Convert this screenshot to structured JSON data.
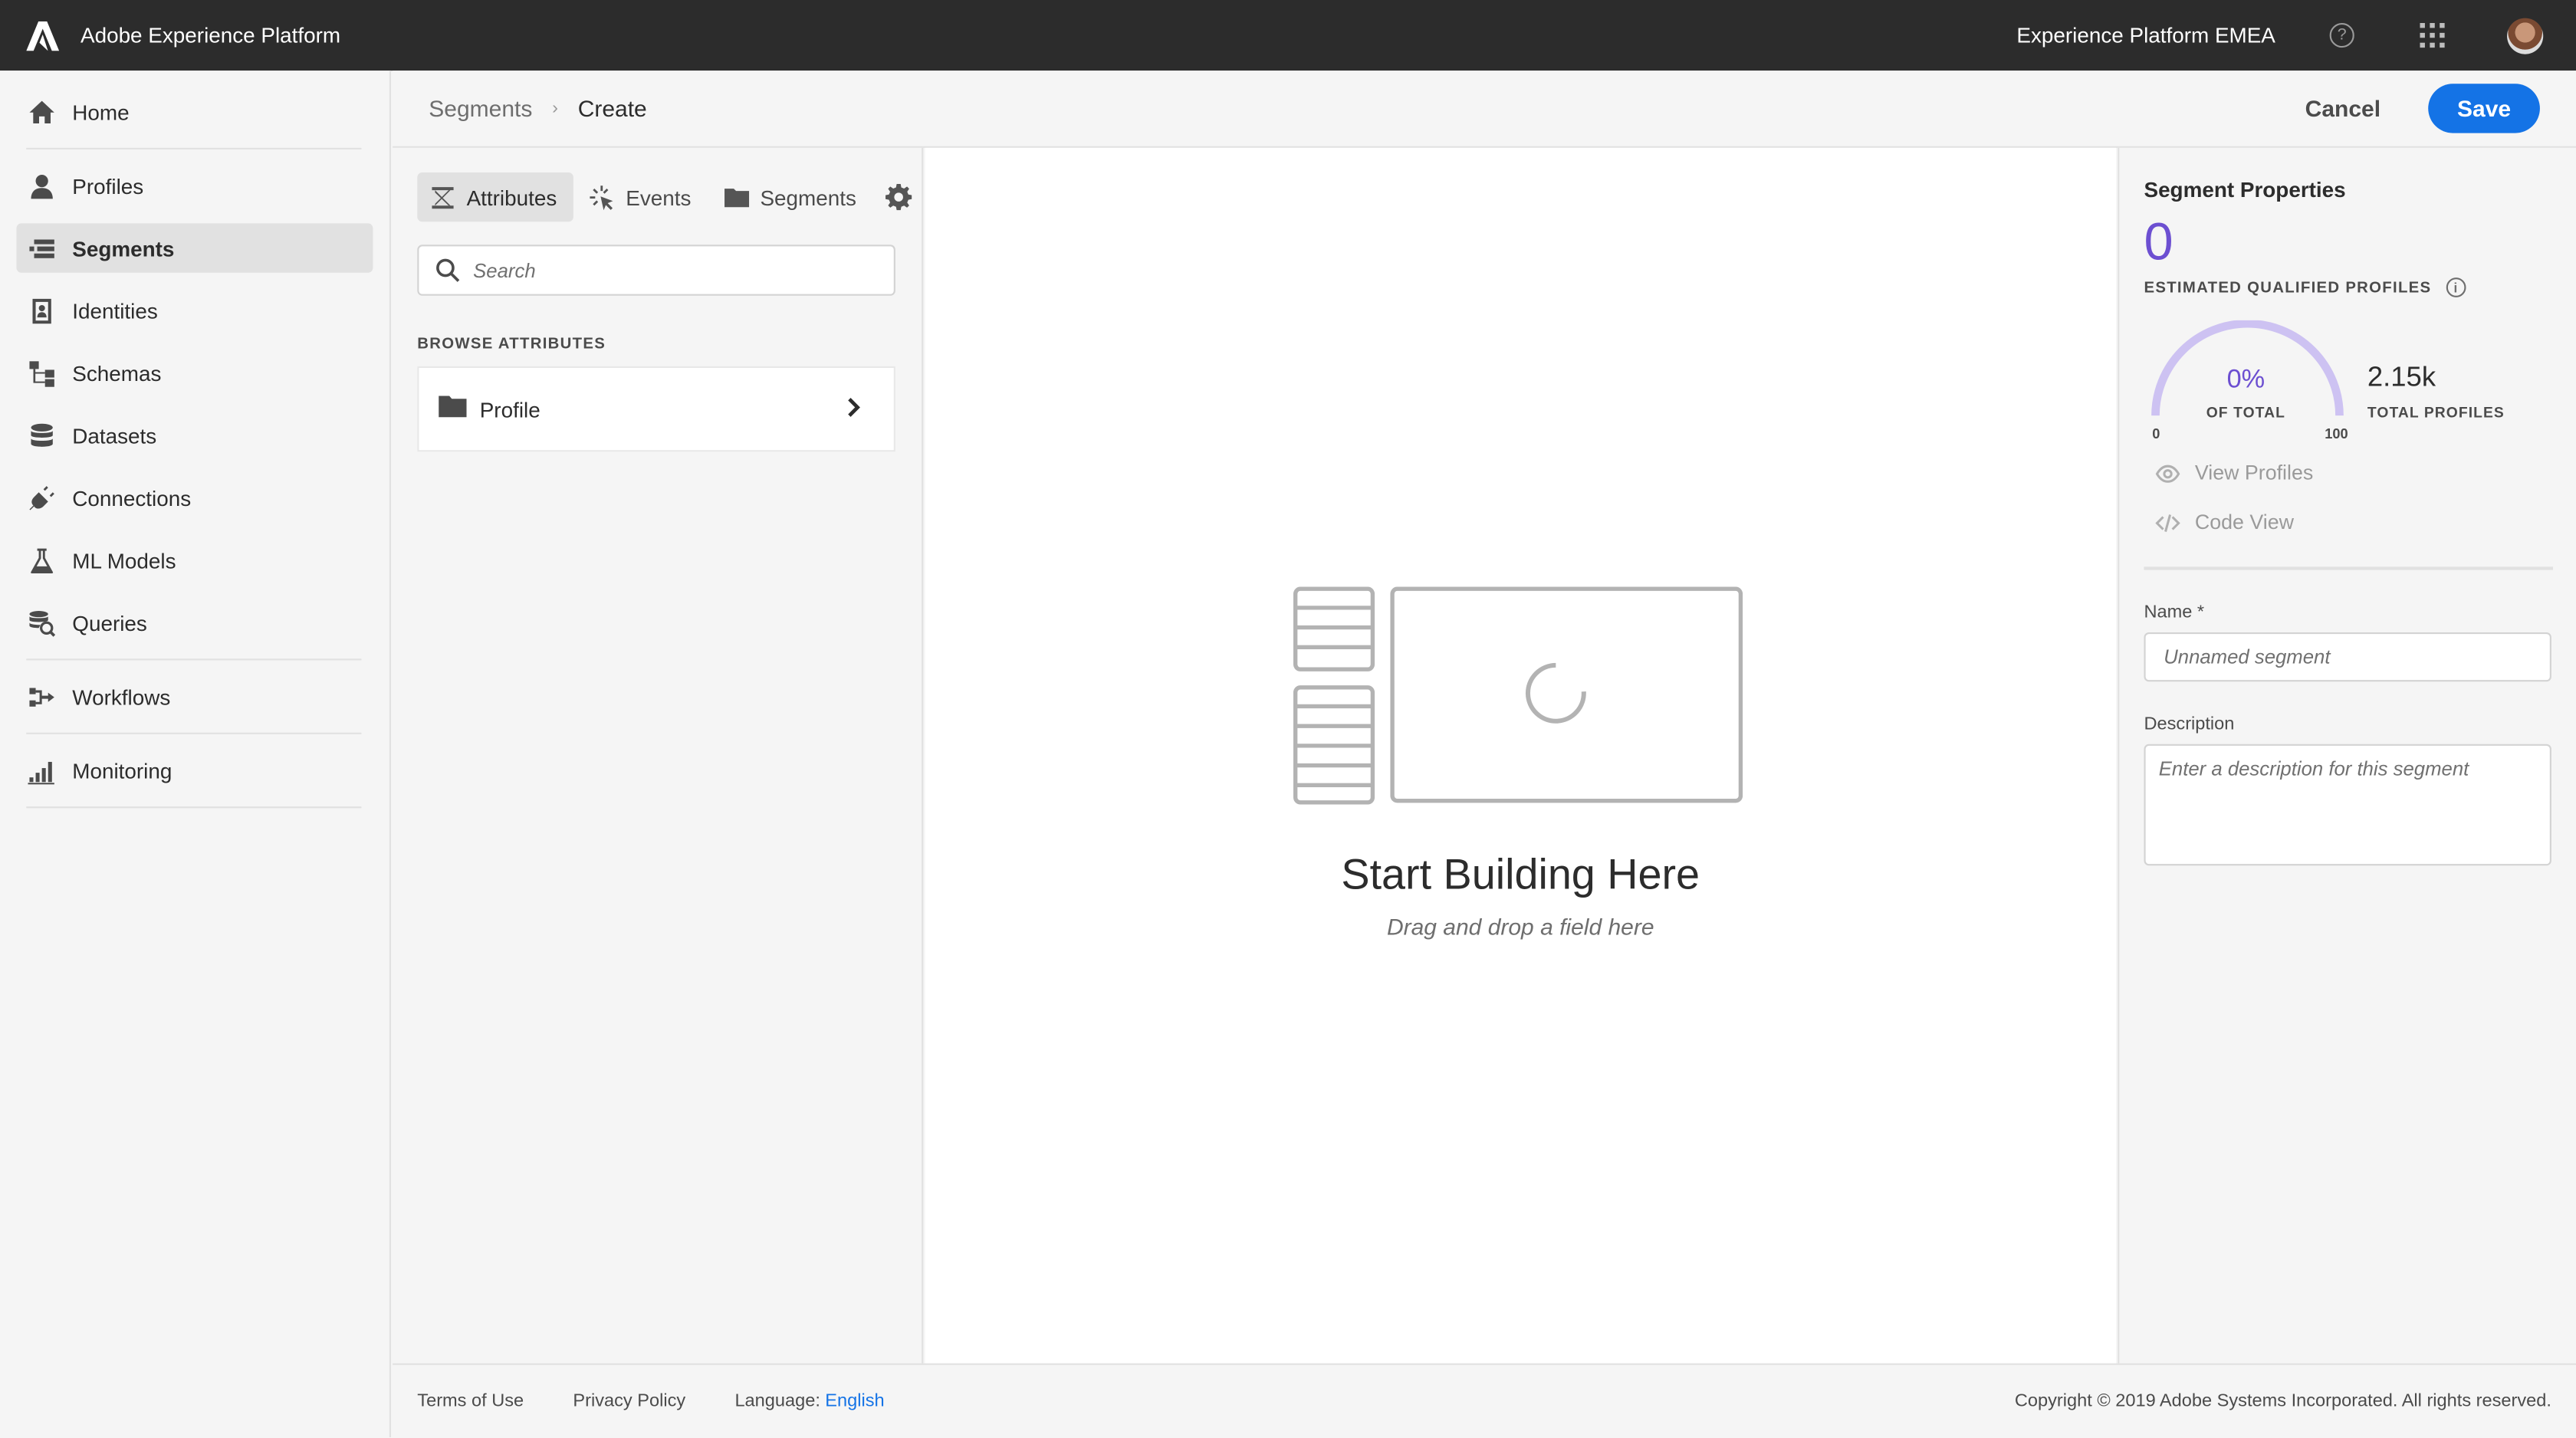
{
  "app": {
    "title": "Adobe Experience Platform",
    "org_name": "Experience Platform EMEA",
    "help_glyph": "?"
  },
  "sidebar": {
    "items": [
      {
        "label": "Home",
        "icon": "home-icon"
      },
      {
        "label": "Profiles",
        "icon": "profile-icon"
      },
      {
        "label": "Segments",
        "icon": "segments-icon",
        "active": true
      },
      {
        "label": "Identities",
        "icon": "identity-icon"
      },
      {
        "label": "Schemas",
        "icon": "schema-icon"
      },
      {
        "label": "Datasets",
        "icon": "database-icon"
      },
      {
        "label": "Connections",
        "icon": "plug-icon"
      },
      {
        "label": "ML Models",
        "icon": "flask-icon"
      },
      {
        "label": "Queries",
        "icon": "query-icon"
      },
      {
        "label": "Workflows",
        "icon": "workflow-icon"
      },
      {
        "label": "Monitoring",
        "icon": "chart-icon"
      }
    ]
  },
  "header": {
    "breadcrumb_parent": "Segments",
    "breadcrumb_separator": "›",
    "breadcrumb_current": "Create",
    "cancel_label": "Cancel",
    "save_label": "Save"
  },
  "left_panel": {
    "tabs": [
      {
        "label": "Attributes",
        "icon": "attributes-icon",
        "active": true
      },
      {
        "label": "Events",
        "icon": "events-icon"
      },
      {
        "label": "Segments",
        "icon": "folder-icon"
      }
    ],
    "search_placeholder": "Search",
    "browse_heading": "BROWSE ATTRIBUTES",
    "browse_item": "Profile"
  },
  "canvas": {
    "title": "Start Building Here",
    "subtitle": "Drag and drop a field here"
  },
  "properties": {
    "title": "Segment Properties",
    "estimate": "0",
    "estimate_label": "ESTIMATED QUALIFIED PROFILES",
    "info_glyph": "i",
    "gauge_percent": "0%",
    "gauge_of_total": "OF TOTAL",
    "gauge_min": "0",
    "gauge_max": "100",
    "total_profiles": "2.15k",
    "total_profiles_label": "TOTAL PROFILES",
    "view_profiles": "View Profiles",
    "code_view": "Code View",
    "name_label": "Name *",
    "name_placeholder": "Unnamed segment",
    "description_label": "Description",
    "description_placeholder": "Enter a description for this segment"
  },
  "footer": {
    "terms": "Terms of Use",
    "privacy": "Privacy Policy",
    "language_label": "Language:",
    "language_value": "English",
    "copyright": "Copyright ©  2019 Adobe Systems Incorporated.  All rights reserved."
  },
  "colors": {
    "accent": "#1473e6",
    "topbar": "#2c2c2c",
    "gauge": "#6c4fd1"
  }
}
